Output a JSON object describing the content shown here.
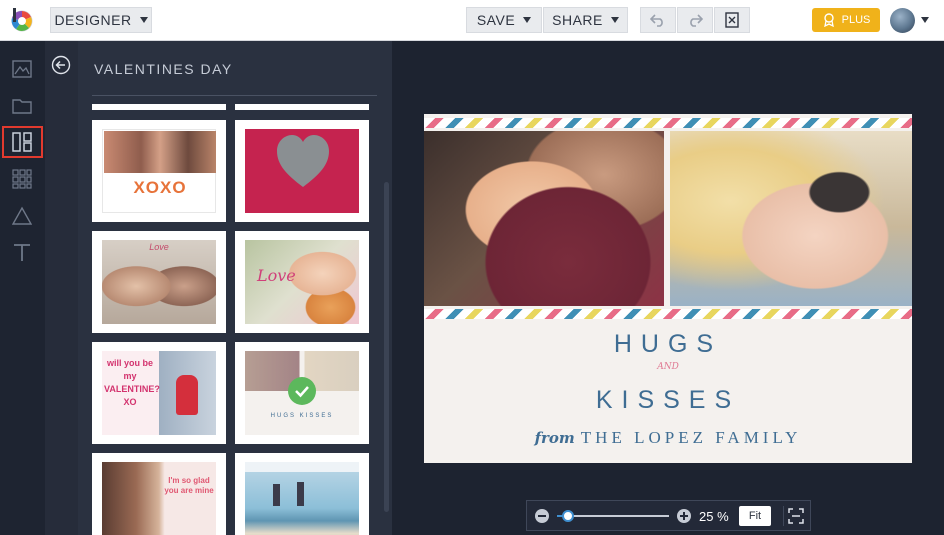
{
  "topbar": {
    "mode_label": "DESIGNER",
    "save_label": "SAVE",
    "share_label": "SHARE",
    "plus_label": "PLUS"
  },
  "panel": {
    "title": "VALENTINES DAY"
  },
  "templates": [
    {
      "name": "xoxo",
      "text": "XOXO"
    },
    {
      "name": "heart-collage",
      "text": ""
    },
    {
      "name": "couple-love",
      "text": "Love"
    },
    {
      "name": "girl-kitten",
      "text": "Love"
    },
    {
      "name": "valentine-xo",
      "text": "will you be my VALENTINE? XO"
    },
    {
      "name": "hugs-kisses-selected",
      "text": "HUGS KISSES"
    },
    {
      "name": "glad-mine",
      "text": "I'm so glad you are mine"
    },
    {
      "name": "beach-couple",
      "text": ""
    }
  ],
  "card": {
    "line1": "HUGS",
    "and": "AND",
    "line2": "KISSES",
    "from": "from",
    "family_name": "THE LOPEZ FAMILY"
  },
  "zoom": {
    "value": "25 %",
    "level": 0.1,
    "fit_label": "Fit"
  },
  "colors": {
    "accent_blue": "#3f6d93",
    "plus_gold": "#f0b21a",
    "rail_active_border": "#e23a2e"
  }
}
